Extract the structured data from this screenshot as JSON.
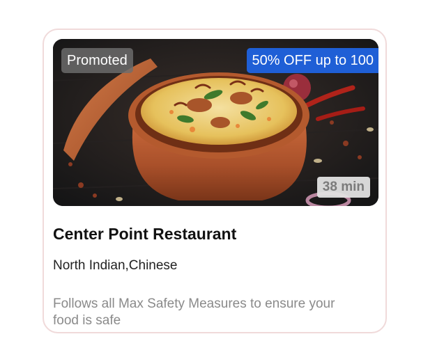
{
  "card": {
    "image_alt": "Biryani in clay pot",
    "promoted_label": "Promoted",
    "offer_label": "50% OFF up to 100",
    "delivery_time": "38 min",
    "restaurant_name": "Center Point Restaurant",
    "cuisines": "North Indian,Chinese",
    "safety_note": "Follows all Max Safety Measures to ensure your food is safe"
  },
  "colors": {
    "offer_badge": "#1f5fd6",
    "card_border": "#f0dada",
    "muted_text": "#8a8a8a"
  }
}
